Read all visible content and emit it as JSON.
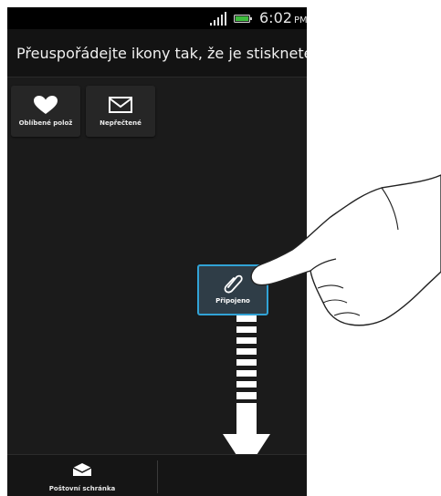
{
  "status_bar": {
    "time": "6:02",
    "ampm": "PM",
    "colors": {
      "battery": "#3dbb3d"
    }
  },
  "header": {
    "title": "Přeuspořádejte ikony tak, že je stisknete a"
  },
  "tiles": [
    {
      "label": "Oblíbené polož",
      "icon": "heart-icon"
    },
    {
      "label": "Nepřečtené",
      "icon": "envelope-icon"
    }
  ],
  "dragging_tile": {
    "label": "Připojeno",
    "icon": "paperclip-icon",
    "highlight_color": "#31a3d6"
  },
  "bottom_bar": {
    "label": "Poštovní schránka",
    "icon": "mailbox-icon"
  }
}
